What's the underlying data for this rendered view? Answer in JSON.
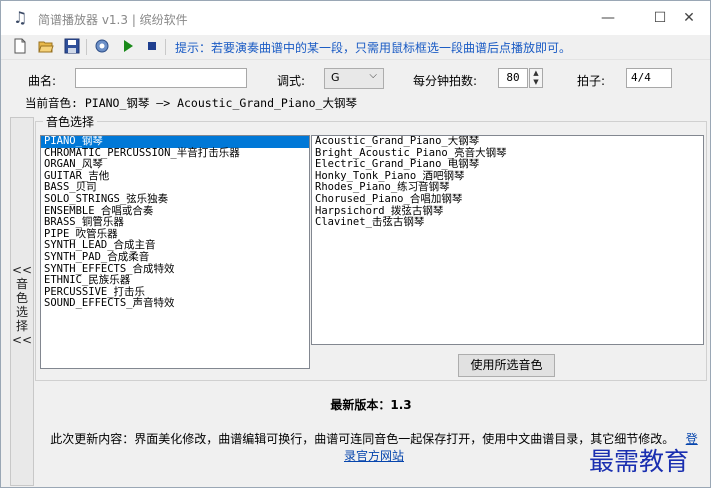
{
  "window": {
    "title": "简谱播放器 v1.3 | 缤纷软件",
    "minimize": "—",
    "maximize": "☐",
    "close": "✕"
  },
  "toolbar": {
    "icons": [
      "new-file-icon",
      "open-folder-icon",
      "save-icon",
      "settings-icon",
      "play-icon",
      "stop-icon",
      "info-icon"
    ],
    "tip": "提示：若要演奏曲谱中的某一段，只需用鼠标框选一段曲谱后点播放即可。"
  },
  "form": {
    "song_label": "曲名:",
    "song_value": "",
    "key_label": "调式:",
    "key_value": "G",
    "bpm_label": "每分钟拍数:",
    "bpm_value": "80",
    "beat_label": "拍子:",
    "beat_value": "4/4"
  },
  "current_instrument": "当前音色: PIANO_钢琴 —> Acoustic_Grand_Piano_大钢琴",
  "collapse_label": [
    "<<",
    "音",
    "色",
    "选",
    "择",
    "<<"
  ],
  "group_title": "音色选择",
  "categories": [
    "PIANO_钢琴",
    "CHROMATIC_PERCUSSION_半音打击乐器",
    "ORGAN_风琴",
    "GUITAR_吉他",
    "BASS_贝司",
    "SOLO_STRINGS_弦乐独奏",
    "ENSEMBLE_合唱或合奏",
    "BRASS_铜管乐器",
    "PIPE_吹管乐器",
    "SYNTH_LEAD_合成主音",
    "SYNTH_PAD_合成柔音",
    "SYNTH_EFFECTS_合成特效",
    "ETHNIC_民族乐器",
    "PERCUSSIVE_打击乐",
    "SOUND_EFFECTS_声音特效"
  ],
  "selected_category_index": 0,
  "instruments": [
    "Acoustic_Grand_Piano_大钢琴",
    "Bright_Acoustic_Piano_亮音大钢琴",
    "Electric_Grand_Piano_电钢琴",
    "Honky_Tonk_Piano_酒吧钢琴",
    "Rhodes_Piano_练习音钢琴",
    "Chorused_Piano_合唱加钢琴",
    "Harpsichord_拨弦古钢琴",
    "Clavinet_击弦古钢琴"
  ],
  "apply_button": "使用所选音色",
  "version_text": "最新版本：1.3",
  "update_notes": "此次更新内容：界面美化修改，曲谱编辑可换行，曲谱可连同音色一起保存打开，使用中文曲谱目录，其它细节修改。",
  "website_link": "登录官方网站",
  "watermark": "最需教育"
}
